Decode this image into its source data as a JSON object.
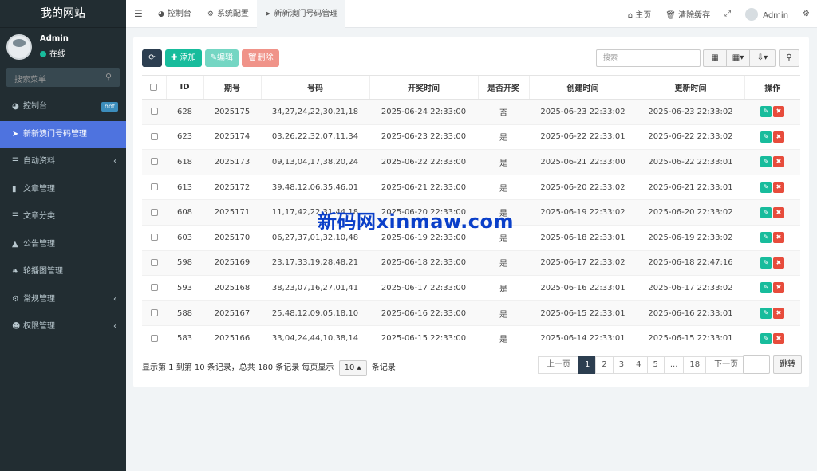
{
  "brand": "我的网站",
  "user": {
    "name": "Admin",
    "status": "在线"
  },
  "side_search_placeholder": "搜索菜单",
  "menu": [
    {
      "icon": "dashboard-icon",
      "label": "控制台",
      "badge": "hot"
    },
    {
      "icon": "paper-plane-icon",
      "label": "新新澳门号码管理",
      "active": true
    },
    {
      "icon": "list-icon",
      "label": "自动资料",
      "chevron": "‹"
    },
    {
      "icon": "bookmark-icon",
      "label": "文章管理"
    },
    {
      "icon": "list-icon",
      "label": "文章分类"
    },
    {
      "icon": "bell-icon",
      "label": "公告管理"
    },
    {
      "icon": "leaf-icon",
      "label": "轮播图管理"
    },
    {
      "icon": "cogs-icon",
      "label": "常规管理",
      "chevron": "‹"
    },
    {
      "icon": "users-icon",
      "label": "权限管理",
      "chevron": "‹"
    }
  ],
  "tabs": [
    {
      "icon": "dashboard-icon",
      "label": "控制台"
    },
    {
      "icon": "gear-icon",
      "label": "系统配置"
    },
    {
      "icon": "paper-plane-icon",
      "label": "新新澳门号码管理",
      "active": true
    }
  ],
  "topright": {
    "home": "主页",
    "clear_cache": "清除缓存",
    "user": "Admin"
  },
  "toolbar": {
    "add": "添加",
    "edit": "编辑",
    "delete": "删除",
    "search_placeholder": "搜索"
  },
  "table": {
    "headers": [
      "ID",
      "期号",
      "号码",
      "开奖时间",
      "是否开奖",
      "创建时间",
      "更新时间",
      "操作"
    ],
    "rows": [
      [
        "628",
        "2025175",
        "34,27,24,22,30,21,18",
        "2025-06-24 22:33:00",
        "否",
        "2025-06-23 22:33:02",
        "2025-06-23 22:33:02"
      ],
      [
        "623",
        "2025174",
        "03,26,22,32,07,11,34",
        "2025-06-23 22:33:00",
        "是",
        "2025-06-22 22:33:01",
        "2025-06-22 22:33:02"
      ],
      [
        "618",
        "2025173",
        "09,13,04,17,38,20,24",
        "2025-06-22 22:33:00",
        "是",
        "2025-06-21 22:33:00",
        "2025-06-22 22:33:01"
      ],
      [
        "613",
        "2025172",
        "39,48,12,06,35,46,01",
        "2025-06-21 22:33:00",
        "是",
        "2025-06-20 22:33:02",
        "2025-06-21 22:33:01"
      ],
      [
        "608",
        "2025171",
        "11,17,42,22,31,44,18",
        "2025-06-20 22:33:00",
        "是",
        "2025-06-19 22:33:02",
        "2025-06-20 22:33:02"
      ],
      [
        "603",
        "2025170",
        "06,27,37,01,32,10,48",
        "2025-06-19 22:33:00",
        "是",
        "2025-06-18 22:33:01",
        "2025-06-19 22:33:02"
      ],
      [
        "598",
        "2025169",
        "23,17,33,19,28,48,21",
        "2025-06-18 22:33:00",
        "是",
        "2025-06-17 22:33:02",
        "2025-06-18 22:47:16"
      ],
      [
        "593",
        "2025168",
        "38,23,07,16,27,01,41",
        "2025-06-17 22:33:00",
        "是",
        "2025-06-16 22:33:01",
        "2025-06-17 22:33:02"
      ],
      [
        "588",
        "2025167",
        "25,48,12,09,05,18,10",
        "2025-06-16 22:33:00",
        "是",
        "2025-06-15 22:33:01",
        "2025-06-16 22:33:01"
      ],
      [
        "583",
        "2025166",
        "33,04,24,44,10,38,14",
        "2025-06-15 22:33:00",
        "是",
        "2025-06-14 22:33:01",
        "2025-06-15 22:33:01"
      ]
    ]
  },
  "footer": {
    "info": "显示第 1 到第 10 条记录，总共 180 条记录 每页显示",
    "page_size": "10",
    "info_suffix": "条记录",
    "pages": [
      "上一页",
      "1",
      "2",
      "3",
      "4",
      "5",
      "...",
      "18",
      "下一页"
    ],
    "jump": "跳转"
  },
  "watermark": "新码网xinmaw.com",
  "colors": {
    "sidebar": "#222d32",
    "active_menu": "#4e73df",
    "success": "#18bc9c",
    "danger": "#e74c3c",
    "dark": "#2c3e50"
  }
}
